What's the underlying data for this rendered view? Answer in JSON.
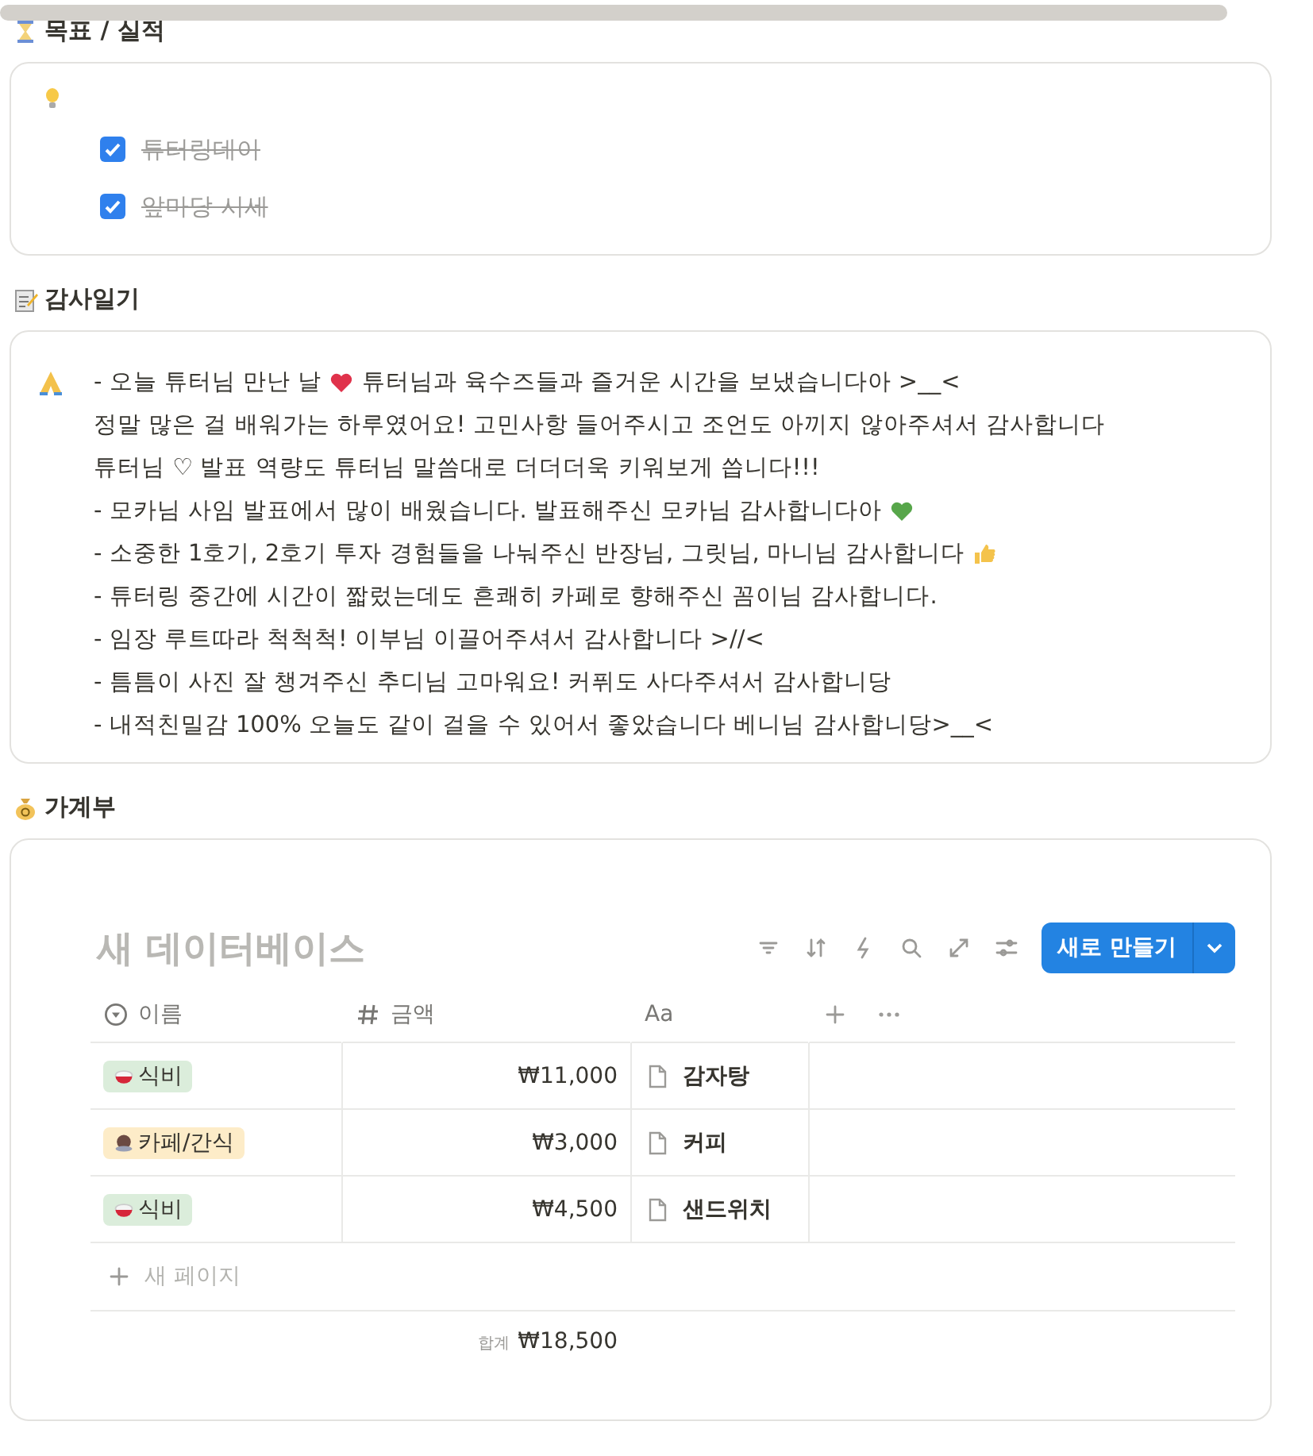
{
  "goals": {
    "heading": "목표 / 실적",
    "checklist": [
      {
        "label": "튜터링데이",
        "checked": true
      },
      {
        "label": "앞마당 시세",
        "checked": true
      }
    ]
  },
  "diary": {
    "heading": "감사일기",
    "lines": [
      [
        {
          "kind": "text",
          "text": "- 오늘 튜터님 만난 날 "
        },
        {
          "kind": "red-heart"
        },
        {
          "kind": "text",
          "text": " 튜터님과 육수즈들과 즐거운 시간을 보냈습니다아 >__<"
        }
      ],
      [
        {
          "kind": "text",
          "text": "정말 많은 걸 배워가는 하루였어요! 고민사항 들어주시고 조언도 아끼지 않아주셔서 감사합니다"
        }
      ],
      [
        {
          "kind": "text",
          "text": "튜터님 ♡ 발표 역량도 튜터님 말씀대로 더더더욱 키워보게 씁니다!!!"
        }
      ],
      [
        {
          "kind": "text",
          "text": "- 모카님 사임 발표에서 많이 배웠습니다. 발표해주신 모카님 감사합니다아 "
        },
        {
          "kind": "green-heart"
        }
      ],
      [
        {
          "kind": "text",
          "text": "- 소중한 1호기, 2호기 투자 경험들을 나눠주신 반장님, 그릿님, 마니님 감사합니다 "
        },
        {
          "kind": "thumb"
        }
      ],
      [
        {
          "kind": "text",
          "text": "- 튜터링 중간에 시간이 짧렀는데도 흔쾌히 카페로 향해주신 꼼이님 감사합니다."
        }
      ],
      [
        {
          "kind": "text",
          "text": "- 임장 루트따라 척척척! 이부님 이끌어주셔서 감사합니다 >//<"
        }
      ],
      [
        {
          "kind": "text",
          "text": "- 틈틈이 사진 잘 챙겨주신 추디님 고마워요! 커퓌도 사다주셔서 감사합니당"
        }
      ],
      [
        {
          "kind": "text",
          "text": "- 내적친밀감 100% 오늘도 같이 걸을 수 있어서 좋았습니다 베니님 감사합니당>__<"
        }
      ]
    ]
  },
  "budget": {
    "heading": "가계부",
    "database": {
      "title": "새 데이터베이스",
      "new_button": "새로 만들기",
      "columns": [
        {
          "kind": "select",
          "label": "이름"
        },
        {
          "kind": "number",
          "label": "금액"
        },
        {
          "kind": "title",
          "label": "Aa"
        }
      ],
      "rows": [
        {
          "category": {
            "label": "식비",
            "kind": "meal",
            "color": "#dbeddb"
          },
          "amount": "₩11,000",
          "name": "감자탕"
        },
        {
          "category": {
            "label": "카페/간식",
            "kind": "cafe",
            "color": "#fdecc8"
          },
          "amount": "₩3,000",
          "name": "커피"
        },
        {
          "category": {
            "label": "식비",
            "kind": "meal",
            "color": "#dbeddb"
          },
          "amount": "₩4,500",
          "name": "샌드위치"
        }
      ],
      "new_page": "새 페이지",
      "total_label": "합계",
      "total": "₩18,500"
    }
  }
}
